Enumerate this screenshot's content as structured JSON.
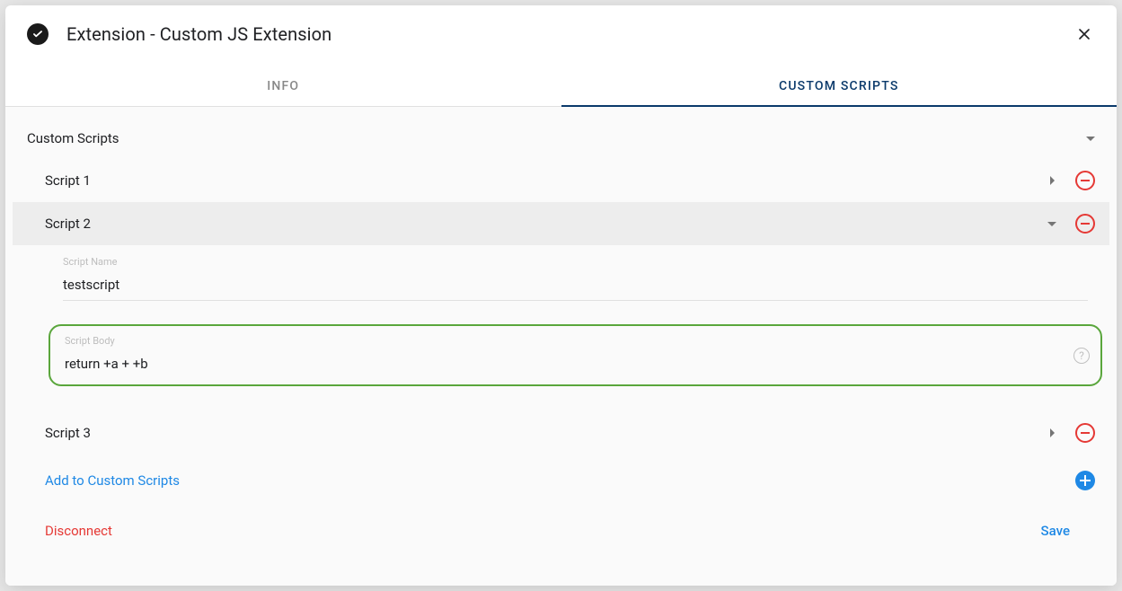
{
  "header": {
    "title": "Extension - Custom JS Extension"
  },
  "tabs": {
    "info": "INFO",
    "custom_scripts": "CUSTOM SCRIPTS"
  },
  "section": {
    "title": "Custom Scripts"
  },
  "scripts": [
    {
      "label": "Script 1"
    },
    {
      "label": "Script 2",
      "name_field_label": "Script Name",
      "name_value": "testscript",
      "body_field_label": "Script Body",
      "body_value": "return +a + +b"
    },
    {
      "label": "Script 3"
    }
  ],
  "add_label": "Add to Custom Scripts",
  "footer": {
    "disconnect": "Disconnect",
    "save": "Save"
  }
}
